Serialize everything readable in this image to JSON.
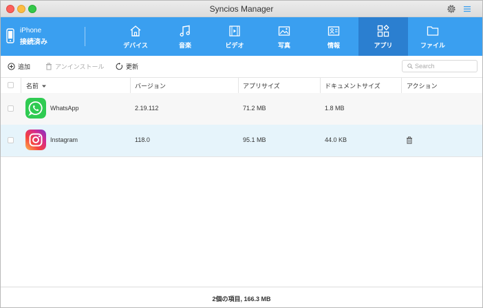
{
  "window": {
    "title": "Syncios Manager"
  },
  "device": {
    "name": "iPhone",
    "status": "接続済み"
  },
  "nav": {
    "tabs": [
      {
        "label": "デバイス",
        "icon": "home-icon"
      },
      {
        "label": "音楽",
        "icon": "music-icon"
      },
      {
        "label": "ビデオ",
        "icon": "video-icon"
      },
      {
        "label": "写真",
        "icon": "photo-icon"
      },
      {
        "label": "情報",
        "icon": "contact-icon"
      },
      {
        "label": "アプリ",
        "icon": "apps-icon",
        "active": true
      },
      {
        "label": "ファイル",
        "icon": "folder-icon"
      }
    ]
  },
  "toolbar": {
    "add_label": "追加",
    "uninstall_label": "アンインストール",
    "refresh_label": "更新",
    "search_placeholder": "Search"
  },
  "table": {
    "columns": [
      "名前",
      "バージョン",
      "アプリサイズ",
      "ドキュメントサイズ",
      "アクション"
    ],
    "rows": [
      {
        "name": "WhatsApp",
        "version": "2.19.112",
        "app_size": "71.2 MB",
        "doc_size": "1.8 MB"
      },
      {
        "name": "Instagram",
        "version": "118.0",
        "app_size": "95.1 MB",
        "doc_size": "44.0 KB"
      }
    ]
  },
  "footer": {
    "summary": "2個の項目, 166.3 MB"
  },
  "colors": {
    "nav_bg": "#3a9ff0",
    "nav_active": "#2b7fd0",
    "selected_row": "#e6f4fb"
  }
}
